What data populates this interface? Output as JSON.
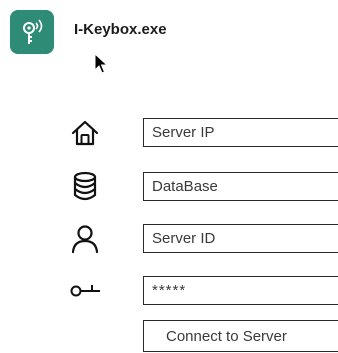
{
  "app": {
    "title": "I-Keybox.exe",
    "icon": "key-wireless-icon",
    "accent_color": "#2e8b75"
  },
  "form": {
    "server_ip": {
      "placeholder": "Server IP",
      "value": "",
      "icon": "home-icon"
    },
    "database": {
      "placeholder": "DataBase",
      "value": "",
      "icon": "database-icon"
    },
    "server_id": {
      "placeholder": "Server ID",
      "value": "",
      "icon": "user-icon"
    },
    "password": {
      "placeholder": "*****",
      "value": "",
      "icon": "key-icon"
    },
    "connect_label": "Connect to Server"
  },
  "cursor": {
    "icon": "mouse-pointer-icon"
  }
}
